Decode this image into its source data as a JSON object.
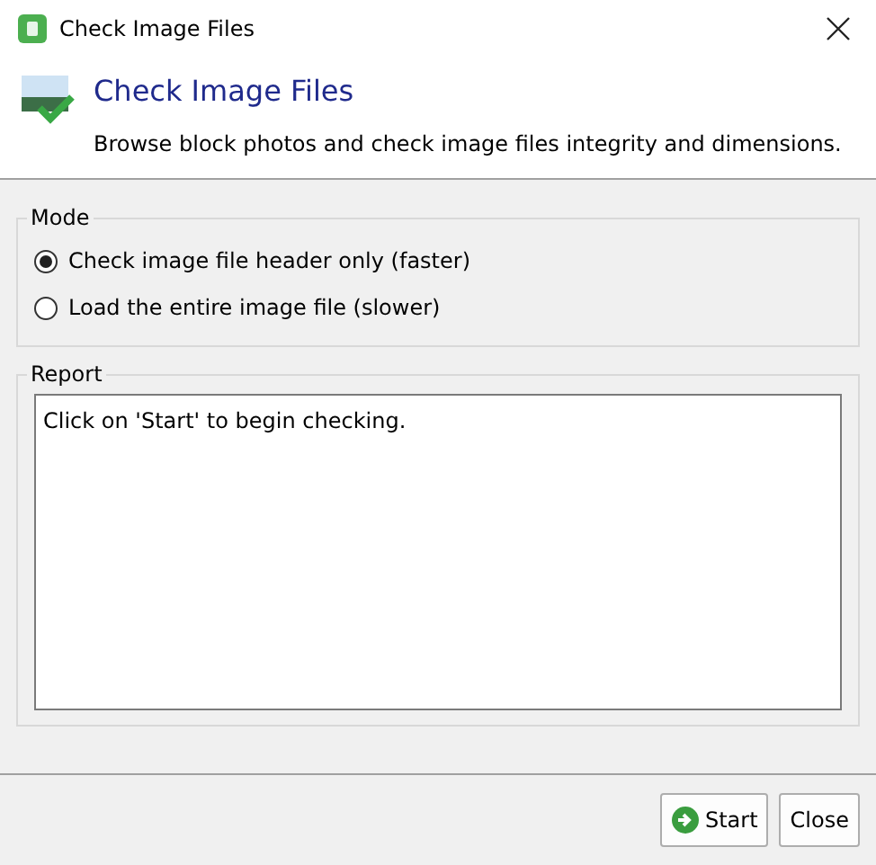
{
  "window": {
    "title": "Check Image Files"
  },
  "header": {
    "title": "Check Image Files",
    "description": "Browse block photos and check image files integrity and dimensions."
  },
  "mode": {
    "label": "Mode",
    "options": [
      {
        "label": "Check image file header only (faster)",
        "selected": true
      },
      {
        "label": "Load the entire image file (slower)",
        "selected": false
      }
    ]
  },
  "report": {
    "label": "Report",
    "text": "Click on 'Start' to begin checking."
  },
  "buttons": [
    {
      "label": "Start",
      "kind": "start"
    },
    {
      "label": "Close",
      "kind": "close"
    }
  ]
}
